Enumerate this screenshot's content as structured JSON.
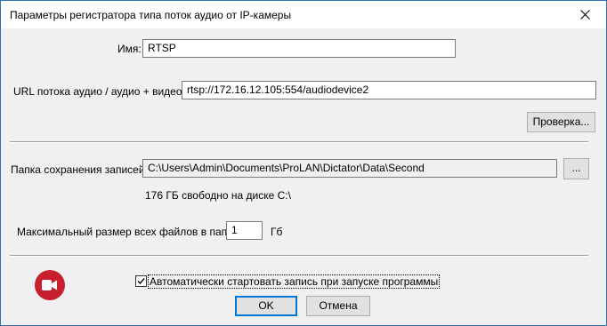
{
  "window": {
    "title": "Параметры регистратора типа поток аудио от IP-камеры",
    "close_icon": "close-icon"
  },
  "form": {
    "name_label": "Имя:",
    "name_value": "RTSP",
    "url_label": "URL потока аудио / аудио + видео:",
    "url_value": "rtsp://172.16.12.105:554/audiodevice2",
    "check_label": "Проверка...",
    "folder_label": "Папка сохранения записей:",
    "folder_value": "C:\\Users\\Admin\\Documents\\ProLAN\\Dictator\\Data\\Second",
    "browse_label": "...",
    "free_space": "176 ГБ свободно на диске C:\\",
    "maxsize_label": "Максимальный размер всех файлов в папке:",
    "maxsize_value": "1",
    "maxsize_unit": "Гб",
    "autostart_label": "Автоматически стартовать запись при запуске программы",
    "autostart_checked": true
  },
  "buttons": {
    "ok": "OK",
    "cancel": "Отмена"
  },
  "logo": {
    "icon": "video-camera-icon",
    "color": "#c8202e"
  }
}
